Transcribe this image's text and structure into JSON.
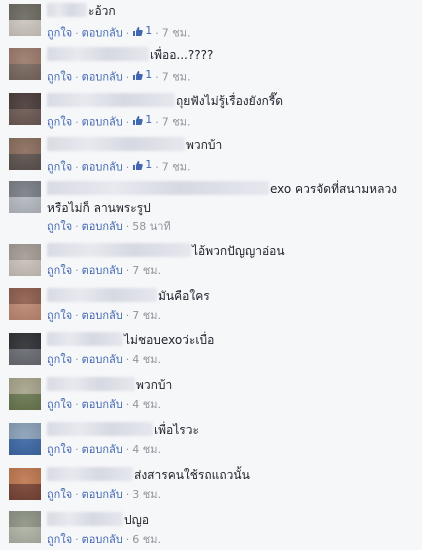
{
  "comments": [
    {
      "text": "",
      "fragment_before": "ะอ้วก",
      "like_label": "ถูกใจ",
      "reply_label": "ตอบกลับ",
      "like_count": "1",
      "time": "7 ชม.",
      "avatar_top": "#6d6b60",
      "avatar_bottom": "#cfc9c0"
    },
    {
      "text": "เพื่ออ...????",
      "like_label": "ถูกใจ",
      "reply_label": "ตอบกลับ",
      "like_count": "1",
      "time": "7 ชม.",
      "avatar_top": "#9c7b6b",
      "avatar_bottom": "#7a6a60"
    },
    {
      "text": "ถุยฟังไม่รู้เรื่องยังกรี๊ด",
      "like_label": "ถูกใจ",
      "reply_label": "ตอบกลับ",
      "like_count": "1",
      "time": "7 ชม.",
      "avatar_top": "#4a3c3a",
      "avatar_bottom": "#6e5a55"
    },
    {
      "text": "พวกบ้า",
      "like_label": "ถูกใจ",
      "reply_label": "ตอบกลับ",
      "like_count": "1",
      "time": "7 ชม.",
      "avatar_top": "#8b6e5e",
      "avatar_bottom": "#5e5450"
    },
    {
      "text": "exo ควรจัดที่สนามหลวง",
      "text_line2": "หรือไม่ก็ ลานพระรูป",
      "like_label": "ถูกใจ",
      "reply_label": "ตอบกลับ",
      "like_count": "",
      "time": "58 นาที",
      "avatar_top": "#7a7e86",
      "avatar_bottom": "#b8bcc4"
    },
    {
      "text": "ไอ้พวกปัญญาอ่อน",
      "like_label": "ถูกใจ",
      "reply_label": "ตอบกลับ",
      "like_count": "",
      "time": "7 ชม.",
      "avatar_top": "#a49c94",
      "avatar_bottom": "#cbc4bc"
    },
    {
      "text": "มันคือใคร",
      "like_label": "ถูกใจ",
      "reply_label": "ตอบกลับ",
      "like_count": "",
      "time": "7 ชม.",
      "avatar_top": "#8f5e4e",
      "avatar_bottom": "#c08a74"
    },
    {
      "text": "ไม่ชอบexoว่ะเบื่อ",
      "like_label": "ถูกใจ",
      "reply_label": "ตอบกลับ",
      "like_count": "",
      "time": "4 ชม.",
      "avatar_top": "#2e3034",
      "avatar_bottom": "#6a6e74"
    },
    {
      "text": "พวกบ้า",
      "like_label": "ถูกใจ",
      "reply_label": "ตอบกลับ",
      "like_count": "",
      "time": "4 ชม.",
      "avatar_top": "#a8a58c",
      "avatar_bottom": "#6c7a52"
    },
    {
      "text": "เพื่อไรวะ",
      "like_label": "ถูกใจ",
      "reply_label": "ตอบกลับ",
      "like_count": "",
      "time": "4 ชม.",
      "avatar_top": "#8aa0b8",
      "avatar_bottom": "#3f6aa8"
    },
    {
      "text": "ส่งสารคนใช้รถแถวนั้น",
      "like_label": "ถูกใจ",
      "reply_label": "ตอบกลับ",
      "like_count": "",
      "time": "3 ชม.",
      "avatar_top": "#c07850",
      "avatar_bottom": "#7a4636"
    },
    {
      "text": "ปญอ",
      "like_label": "ถูกใจ",
      "reply_label": "ตอบกลับ",
      "like_count": "",
      "time": "6 ชม.",
      "avatar_top": "#8e9486",
      "avatar_bottom": "#b2b6a8"
    }
  ]
}
